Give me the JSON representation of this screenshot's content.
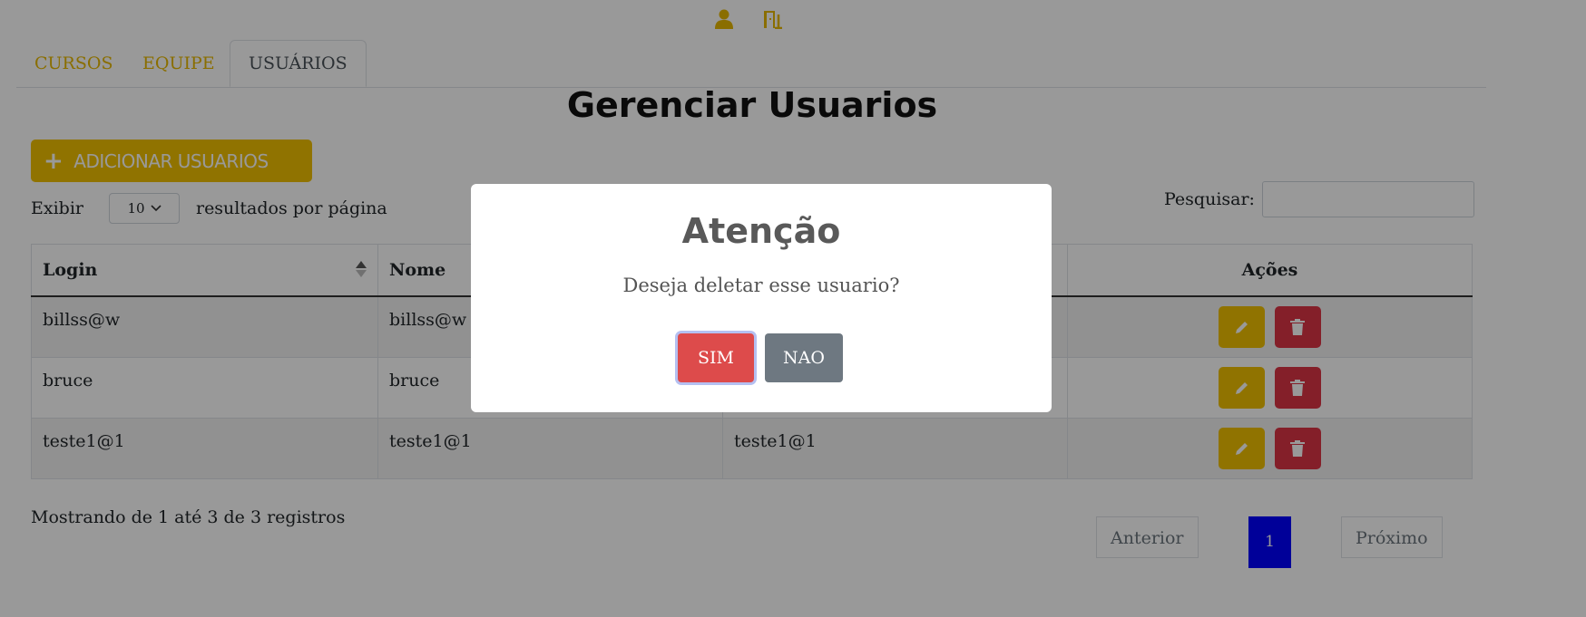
{
  "colors": {
    "accent": "#f0c000",
    "danger": "#dc3545",
    "confirm": "#dd4b4b",
    "secondary": "#6e7881",
    "page_active": "#0000ff"
  },
  "top_icons": [
    "user-icon",
    "door-exit-icon"
  ],
  "tabs": [
    {
      "label": "CURSOS",
      "active": false
    },
    {
      "label": "EQUIPE",
      "active": false
    },
    {
      "label": "USUÁRIOS",
      "active": true
    }
  ],
  "page_title": "Gerenciar Usuarios",
  "add_button": {
    "label": "ADICIONAR USUARIOS",
    "icon": "plus-icon"
  },
  "length_menu": {
    "prefix": "Exibir",
    "value": "10",
    "suffix": "resultados por página"
  },
  "search": {
    "label": "Pesquisar:",
    "value": ""
  },
  "table": {
    "columns": [
      "Login",
      "Nome",
      "",
      "Ações"
    ],
    "rows": [
      {
        "login": "billss@w",
        "nome": "billss@w",
        "col3": ""
      },
      {
        "login": "bruce",
        "nome": "bruce",
        "col3": ""
      },
      {
        "login": "teste1@1",
        "nome": "teste1@1",
        "col3": "teste1@1"
      }
    ],
    "row_actions": [
      "pencil-icon",
      "trash-icon"
    ]
  },
  "info": "Mostrando de 1 até 3 de 3 registros",
  "pagination": {
    "previous": "Anterior",
    "current": "1",
    "next": "Próximo"
  },
  "modal": {
    "title": "Atenção",
    "message": "Deseja deletar esse usuario?",
    "confirm": "SIM",
    "cancel": "NAO"
  }
}
